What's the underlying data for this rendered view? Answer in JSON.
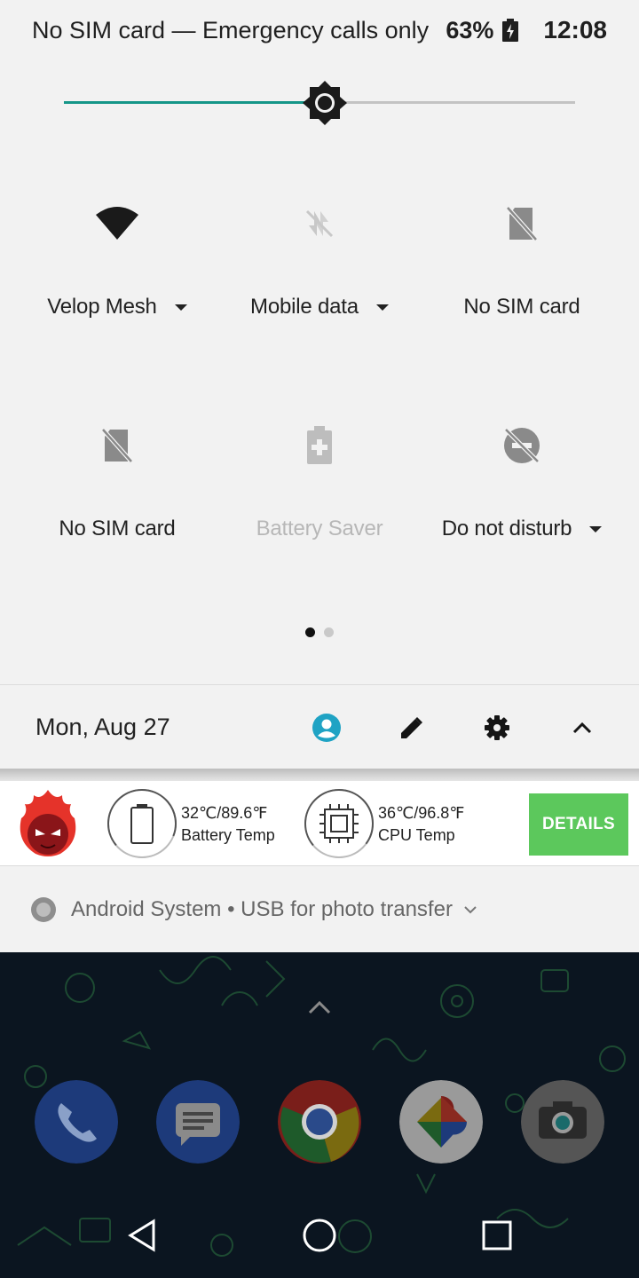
{
  "status_bar": {
    "carrier": "No SIM card — Emergency calls only",
    "battery": "63%",
    "time": "12:08"
  },
  "brightness": {
    "level": 0.51
  },
  "tiles": [
    {
      "label": "Velop Mesh",
      "icon": "wifi-icon",
      "has_menu": true,
      "enabled": true
    },
    {
      "label": "Mobile data",
      "icon": "mobile-data-off-icon",
      "has_menu": true,
      "enabled": false
    },
    {
      "label": "No SIM card",
      "icon": "no-sim-icon",
      "has_menu": false,
      "enabled": true
    },
    {
      "label": "No SIM card",
      "icon": "no-sim-icon",
      "has_menu": false,
      "enabled": true
    },
    {
      "label": "Battery Saver",
      "icon": "battery-saver-icon",
      "has_menu": false,
      "enabled": false
    },
    {
      "label": "Do not disturb",
      "icon": "do-not-disturb-icon",
      "has_menu": true,
      "enabled": true
    }
  ],
  "pager": {
    "pages": 2,
    "current": 1
  },
  "date_row": {
    "date": "Mon, Aug 27",
    "icons": [
      "user-icon",
      "edit-icon",
      "settings-icon",
      "collapse-icon"
    ]
  },
  "antutu": {
    "battery_temp_value": "32℃/89.6℉",
    "battery_temp_label": "Battery Temp",
    "cpu_temp_value": "36℃/96.8℉",
    "cpu_temp_label": "CPU Temp",
    "details_label": "DETAILS",
    "accent": "#5cc85c"
  },
  "system_notification": {
    "app": "Android System",
    "separator": "•",
    "text": "USB for photo transfer"
  },
  "dock": {
    "apps": [
      "phone-app-icon",
      "messages-app-icon",
      "chrome-app-icon",
      "photos-app-icon",
      "camera-app-icon"
    ]
  },
  "colors": {
    "brightness_accent": "#159688",
    "user_icon": "#1fa3c4",
    "shade_background": "#f2f2f2"
  }
}
